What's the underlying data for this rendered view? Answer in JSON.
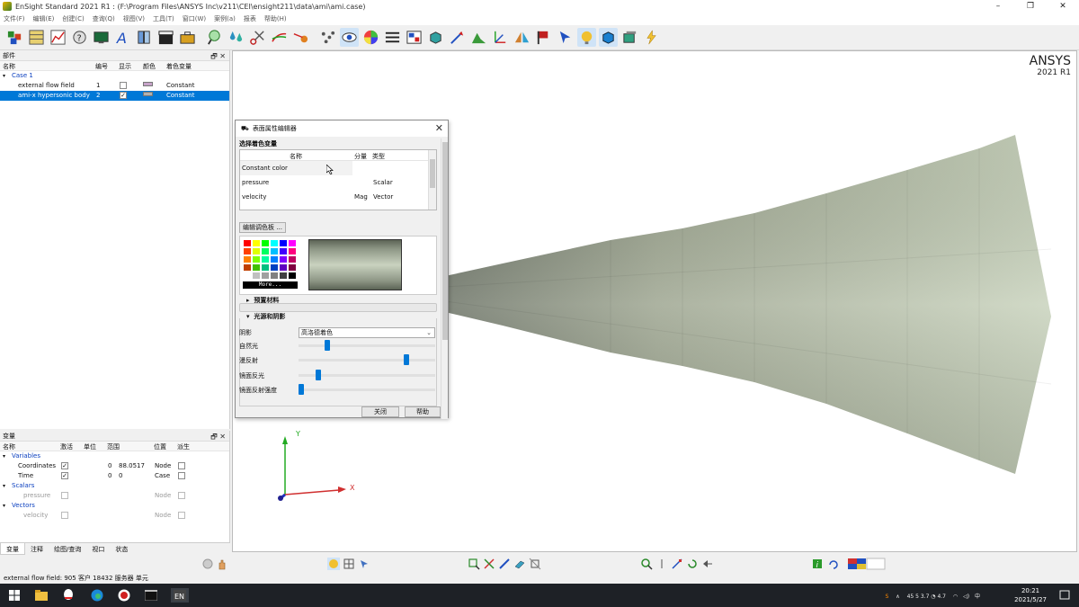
{
  "window": {
    "title": "EnSight Standard 2021 R1 : (F:\\Program Files\\ANSYS Inc\\v211\\CEI\\ensight211\\data\\ami\\ami.case)",
    "minimize": "–",
    "maximize": "❐",
    "close": "✕"
  },
  "menu": [
    "文件(F)",
    "编辑(E)",
    "创建(C)",
    "查询(Q)",
    "视图(V)",
    "工具(T)",
    "窗口(W)",
    "案例(a)",
    "报表",
    "帮助(H)"
  ],
  "parts_panel": {
    "title": "部件",
    "controls": "🗗 ✕",
    "columns": {
      "name": "名称",
      "id": "编号",
      "show": "显示",
      "color": "颜色",
      "color_var": "着色变量"
    },
    "case_label": "Case 1",
    "rows": [
      {
        "name": "external flow field",
        "id": "1",
        "show": "",
        "color": "#c7a3c9",
        "color_var": "Constant"
      },
      {
        "name": "ami-x hypersonic body",
        "id": "2",
        "show": "✓",
        "color": "#b0b0b0",
        "color_var": "Constant"
      }
    ]
  },
  "vars_panel": {
    "title": "变量",
    "controls": "🗗 ✕",
    "columns": {
      "name": "名称",
      "active": "激活",
      "unit": "单位",
      "range": "范围",
      "location": "位置",
      "derived": "派生"
    },
    "groups": {
      "variables": "Variables",
      "scalars": "Scalars",
      "vectors": "Vectors"
    },
    "rows": [
      {
        "name": "Coordinates",
        "active": "✓",
        "range_min": "0",
        "range_max": "88.0517",
        "location": "Node"
      },
      {
        "name": "Time",
        "active": "✓",
        "range_min": "0",
        "range_max": "0",
        "location": "Case"
      },
      {
        "name": "pressure",
        "active": "",
        "range_min": "",
        "range_max": "",
        "location": "Node"
      },
      {
        "name": "velocity",
        "active": "",
        "range_min": "",
        "range_max": "",
        "location": "Node"
      }
    ]
  },
  "tabs": [
    "变量",
    "注释",
    "绘图/查询",
    "视口",
    "状态"
  ],
  "viewport": {
    "brand": "ANSYS",
    "version": "2021 R1",
    "axis_x": "X",
    "axis_y": "Y",
    "body_color": "#c8d2bc"
  },
  "dialog": {
    "title": "表面属性编辑器",
    "close": "✕",
    "select_var_label": "选择着色变量",
    "table_headers": {
      "name": "名称",
      "component": "分量",
      "type": "类型"
    },
    "table_rows": [
      {
        "name": "Constant color",
        "component": "",
        "type": ""
      },
      {
        "name": "pressure",
        "component": "",
        "type": "Scalar"
      },
      {
        "name": "velocity",
        "component": "Mag",
        "type": "Vector"
      }
    ],
    "edit_palette": "编辑调色板 ...",
    "more": "More...",
    "preset_section": "预置材料",
    "lighting_section": "光源和阴影",
    "shading_label": "阴影",
    "shading_value": "高洛德着色",
    "sliders": [
      {
        "label": "自然光",
        "level": 0.2
      },
      {
        "label": "漫反射",
        "level": 0.8
      },
      {
        "label": "镜面反光",
        "level": 0.13
      },
      {
        "label": "镜面反射强度",
        "level": 0.0
      }
    ],
    "close_btn": "关闭",
    "help_btn": "帮助"
  },
  "status": "external flow field: 905 客户 18432 服务器 单元",
  "taskbar": {
    "tray": "45  5  3.7  ◔  4.7",
    "time": "20:21",
    "date": "2021/5/27"
  }
}
